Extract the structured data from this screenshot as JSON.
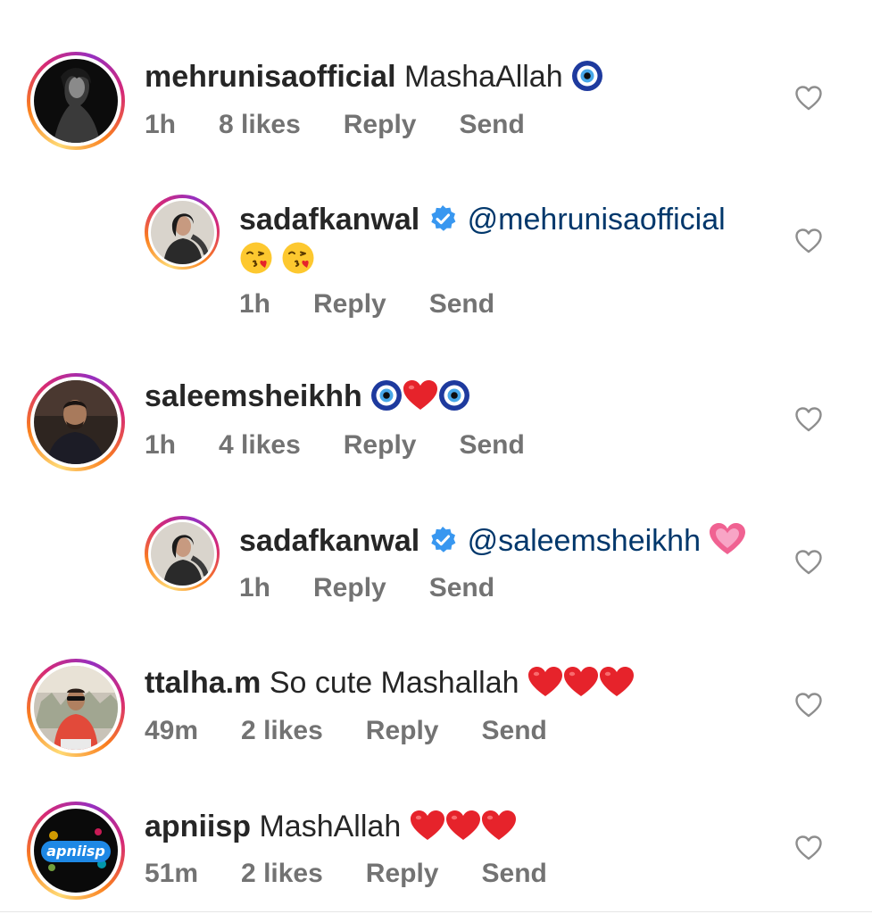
{
  "comments": [
    {
      "username": "mehrunisaofficial",
      "text": "MashaAllah",
      "time": "1h",
      "likes": "8 likes",
      "reply": "Reply",
      "send": "Send"
    },
    {
      "username": "sadafkanwal",
      "mention": "@mehrunisaofficial",
      "time": "1h",
      "reply": "Reply",
      "send": "Send"
    },
    {
      "username": "saleemsheikhh",
      "time": "1h",
      "likes": "4 likes",
      "reply": "Reply",
      "send": "Send"
    },
    {
      "username": "sadafkanwal",
      "mention": "@saleemsheikhh",
      "time": "1h",
      "reply": "Reply",
      "send": "Send"
    },
    {
      "username": "ttalha.m",
      "text": "So cute Mashallah",
      "time": "49m",
      "likes": "2 likes",
      "reply": "Reply",
      "send": "Send"
    },
    {
      "username": "apniisp",
      "text": "MashAllah",
      "time": "51m",
      "likes": "2 likes",
      "reply": "Reply",
      "send": "Send",
      "avatar_logo": "apniisp"
    }
  ],
  "icons": {
    "heart": "heart-outline-icon",
    "verified": "verified-badge-icon",
    "nazar": "nazar-amulet-emoji",
    "red_heart": "red-heart-emoji",
    "kiss": "kissing-face-emoji",
    "pink_heart": "growing-heart-emoji"
  },
  "colors": {
    "text": "#262626",
    "meta": "#737373",
    "mention": "#00376b",
    "verified": "#3897f0",
    "heart_outline": "#8e8e8e"
  }
}
